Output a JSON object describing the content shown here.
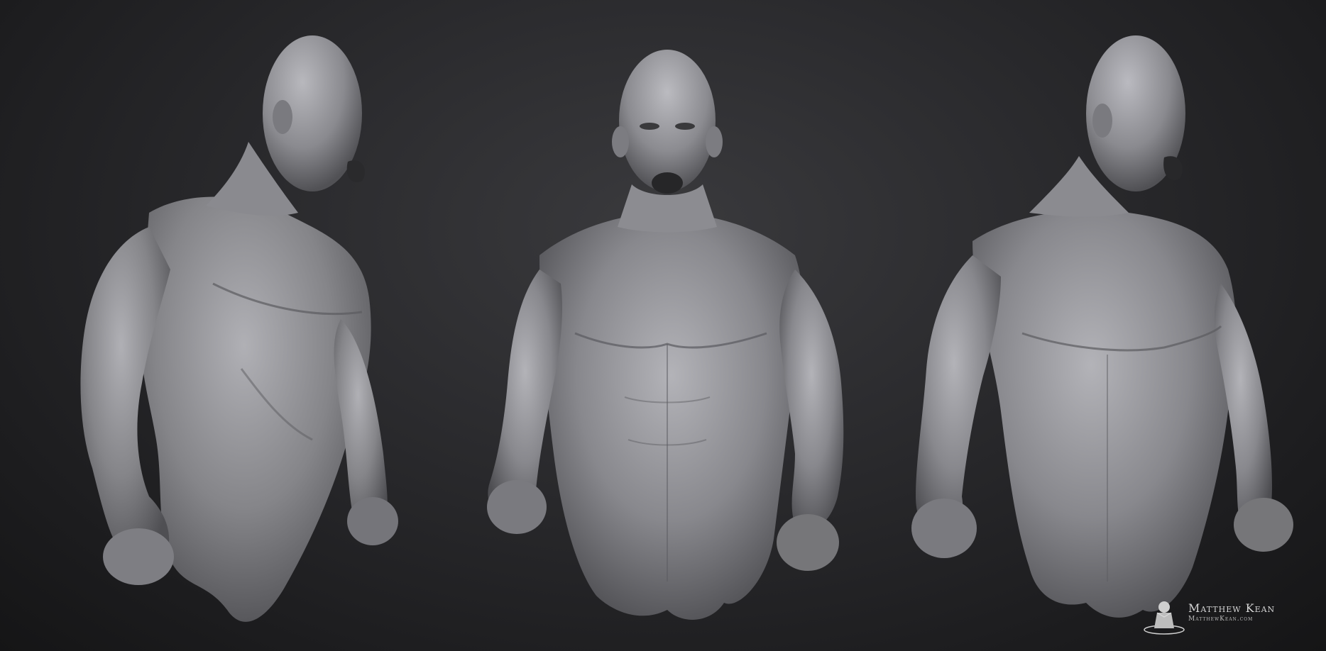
{
  "image": {
    "subject": "Three views of a sculpted grey male torso with clenched fists and a screaming expression",
    "background_color": "#2b2b2e",
    "sculpt_color": "#8e8e93"
  },
  "figures": [
    {
      "view": "three-quarter left"
    },
    {
      "view": "front"
    },
    {
      "view": "three-quarter right"
    }
  ],
  "watermark": {
    "name": "Matthew Kean",
    "site": "MatthewKean.com"
  }
}
